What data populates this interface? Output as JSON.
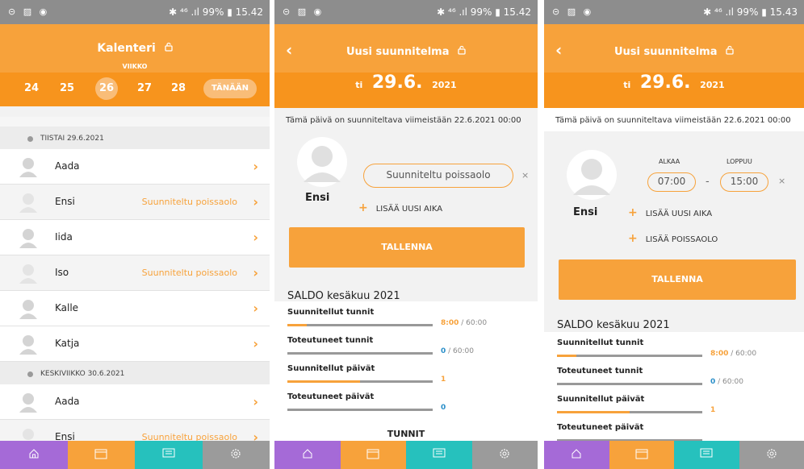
{
  "status": {
    "p1": {
      "left": "⊝ ▨ ◉",
      "right": "✱ ⁴⁶ .ıl 99% ▮ 15.42"
    },
    "p2": {
      "left": "⊝ ▨ ◉",
      "right": "✱ ⁴⁶ .ıl 99% ▮ 15.42"
    },
    "p3": {
      "left": "⊝ ▨ ◉",
      "right": "✱ ⁴⁶ .ıl 99% ▮ 15.43"
    }
  },
  "calendar": {
    "title": "Kalenteri",
    "week_label": "VIIKKO",
    "weeks": [
      "24",
      "25",
      "26",
      "27",
      "28"
    ],
    "selected_week": "26",
    "today_button": "TÄNÄÄN",
    "days": [
      {
        "header": "TIISTAI 29.6.2021",
        "rows": [
          {
            "name": "Aada",
            "status": ""
          },
          {
            "name": "Ensi",
            "status": "Suunniteltu poissaolo"
          },
          {
            "name": "Iida",
            "status": ""
          },
          {
            "name": "Iso",
            "status": "Suunniteltu poissaolo"
          },
          {
            "name": "Kalle",
            "status": ""
          },
          {
            "name": "Katja",
            "status": ""
          }
        ]
      },
      {
        "header": "KESKIVIIKKO 30.6.2021",
        "rows": [
          {
            "name": "Aada",
            "status": ""
          },
          {
            "name": "Ensi",
            "status": "Suunniteltu poissaolo"
          }
        ]
      }
    ]
  },
  "plan": {
    "title": "Uusi suunnitelma",
    "weekday": "ti",
    "date": "29.6.",
    "year": "2021",
    "deadline": "Tämä päivä on suunniteltava viimeistään 22.6.2021 00:00",
    "person": "Ensi",
    "absence_pill": "Suunniteltu poissaolo",
    "add_time": "LISÄÄ UUSI AIKA",
    "add_absence": "LISÄÄ POISSAOLO",
    "save": "TALLENNA",
    "start_label": "ALKAA",
    "end_label": "LOPPUU",
    "start_time": "07:00",
    "end_time": "15:00",
    "dash": "-",
    "saldo_title": "SALDO kesäkuu 2021",
    "tunnit_heading": "TUNNIT",
    "metrics": [
      {
        "label": "Suunnitellut tunnit",
        "value": "8:00",
        "total": "/ 60:00",
        "fraction": 0.133
      },
      {
        "label": "Toteutuneet tunnit",
        "value": "0",
        "total": "/ 60:00",
        "fraction": 0
      },
      {
        "label": "Suunnitellut päivät",
        "value": "1",
        "total": "",
        "fraction": 0.5
      },
      {
        "label": "Toteutuneet päivät",
        "value": "0",
        "total": "",
        "fraction": 0
      }
    ]
  },
  "colors": {
    "orange": "#f7a23b",
    "dark_orange": "#f7941d",
    "home_tab": "#a56ad7",
    "messages_tab": "#26c1bd",
    "settings_tab": "#9b9b9b"
  }
}
